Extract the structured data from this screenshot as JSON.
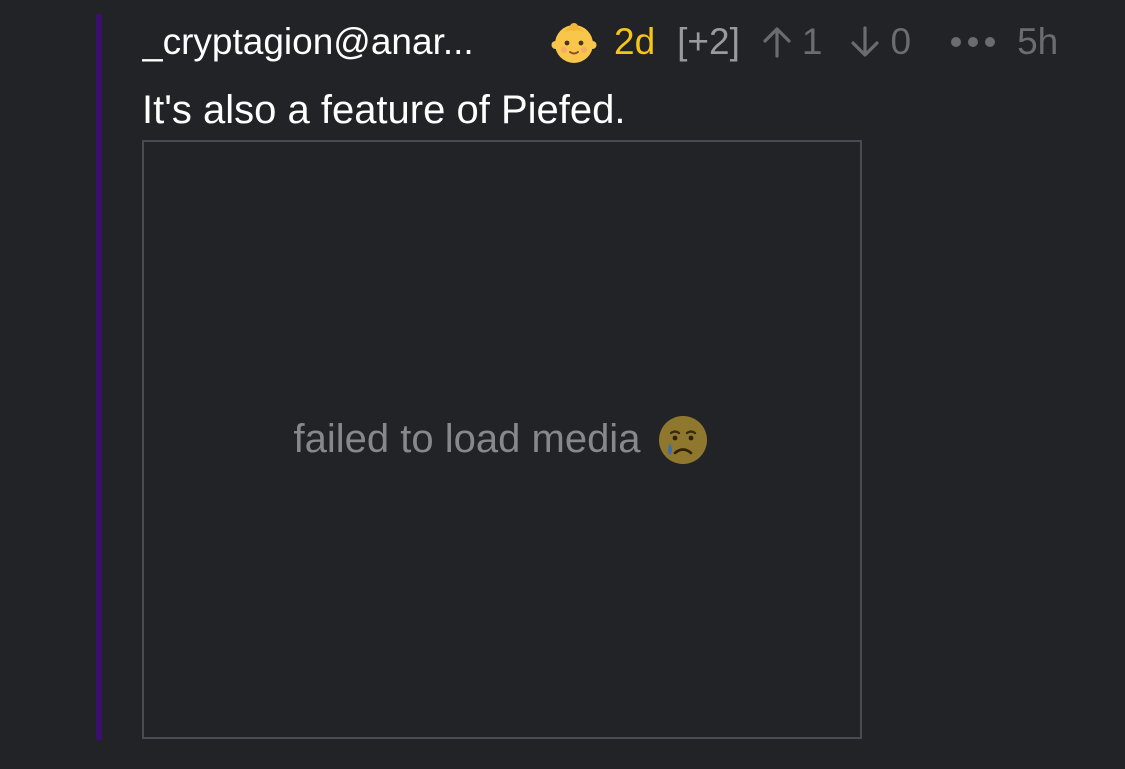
{
  "comment": {
    "author": "_cryptagion@anar...",
    "badge_icon": "baby-emoji-icon",
    "account_age": "2d",
    "score": "[+2]",
    "upvotes": "1",
    "downvotes": "0",
    "time": "5h",
    "body": "It's also a feature of Piefed.",
    "media_error": "failed to load media"
  },
  "colors": {
    "thread_bar": "#3a0f6e",
    "account_age": "#f5c518",
    "background": "#222327"
  }
}
